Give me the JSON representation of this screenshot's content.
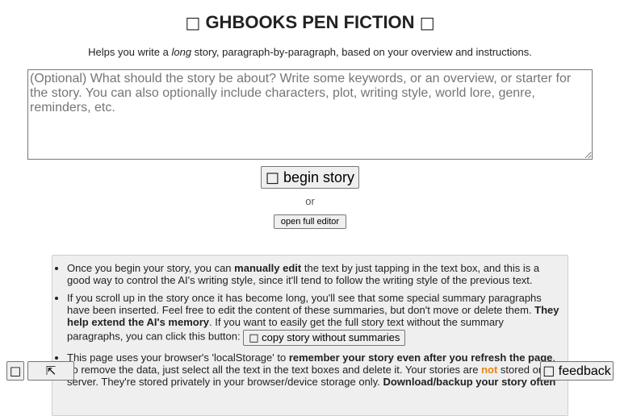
{
  "header": {
    "title": "GHBOOKS PEN FICTION",
    "title_icon_left": "□",
    "title_icon_right": "□",
    "subtitle_before": "Helps you write a ",
    "subtitle_em": "long",
    "subtitle_after": " story, paragraph-by-paragraph, based on your overview and instructions."
  },
  "story_input": {
    "value": "",
    "placeholder": "(Optional) What should the story be about? Write some keywords, or an overview, or starter for the story. You can also optionally include characters, plot, writing style, world lore, genre, reminders, etc."
  },
  "actions": {
    "begin_icon": "□",
    "begin_label": " begin story",
    "or_text": "or",
    "editor_label": "open full editor"
  },
  "info": {
    "item1": {
      "before": "Once you begin your story, you can ",
      "bold": "manually edit",
      "after": " the text by just tapping in the text box, and this is a good way to control the AI's writing style, since it'll tend to follow the writing style of the previous text."
    },
    "item2": {
      "before": "If you scroll up in the story once it has become long, you'll see that some special summary paragraphs have been inserted. Feel free to edit the content of these summaries, but don't move or delete them. ",
      "bold": "They help extend the AI's memory",
      "after": ". If you want to easily get the full story text without the summary paragraphs, you can click this button: ",
      "copy_button_icon": "□",
      "copy_button_label": " copy story without summaries"
    },
    "item3": {
      "before": "This page uses your browser's 'localStorage' to ",
      "bold1": "remember your story even after you refresh the page",
      "middle1": ". To remove the data, just select all the text in the text boxes and delete it. Your stories are ",
      "warn": "not",
      "middle2": " stored on a server. They're stored privately in your browser/device storage only. ",
      "bold2": "Download/backup your story often"
    },
    "warn_color": "#e8870f"
  },
  "footer": {
    "corner_button_1_icon": "□",
    "corner_button_2_icon": "⇱",
    "feedback_icon": "□",
    "feedback_label": " feedback"
  }
}
